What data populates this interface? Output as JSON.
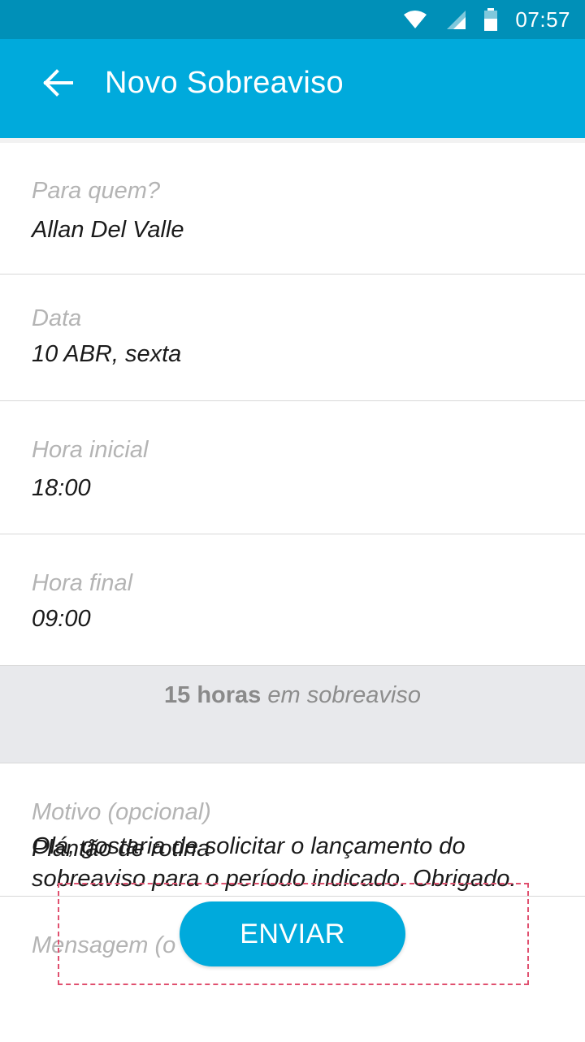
{
  "status_bar": {
    "time": "07:57",
    "icons": [
      "wifi-icon",
      "signal-icon",
      "battery-icon"
    ]
  },
  "app_bar": {
    "back_icon": "arrow-left-icon",
    "title": "Novo Sobreaviso"
  },
  "form": {
    "recipient": {
      "label": "Para quem?",
      "value": "Allan Del Valle"
    },
    "date": {
      "label": "Data",
      "value": "10 ABR, sexta"
    },
    "start_time": {
      "label": "Hora inicial",
      "value": "18:00"
    },
    "end_time": {
      "label": "Hora final",
      "value": "09:00"
    },
    "summary": {
      "hours": "15 horas",
      "suffix": "em sobreaviso"
    },
    "reason": {
      "label": "Motivo (opcional)",
      "value": "Plantão de rotina"
    },
    "message": {
      "label": "Mensagem (o",
      "value": "Olá, gostaria de solicitar o lançamento do sobreaviso para o período indicado. Obrigado."
    }
  },
  "actions": {
    "send_label": "ENVIAR"
  },
  "colors": {
    "status_bar": "#0090b8",
    "app_bar": "#00aadc",
    "button": "#00aadc",
    "label_gray": "#b4b4b4",
    "summary_bg": "#e8e9ec",
    "dashed_outline": "#e0506f"
  }
}
